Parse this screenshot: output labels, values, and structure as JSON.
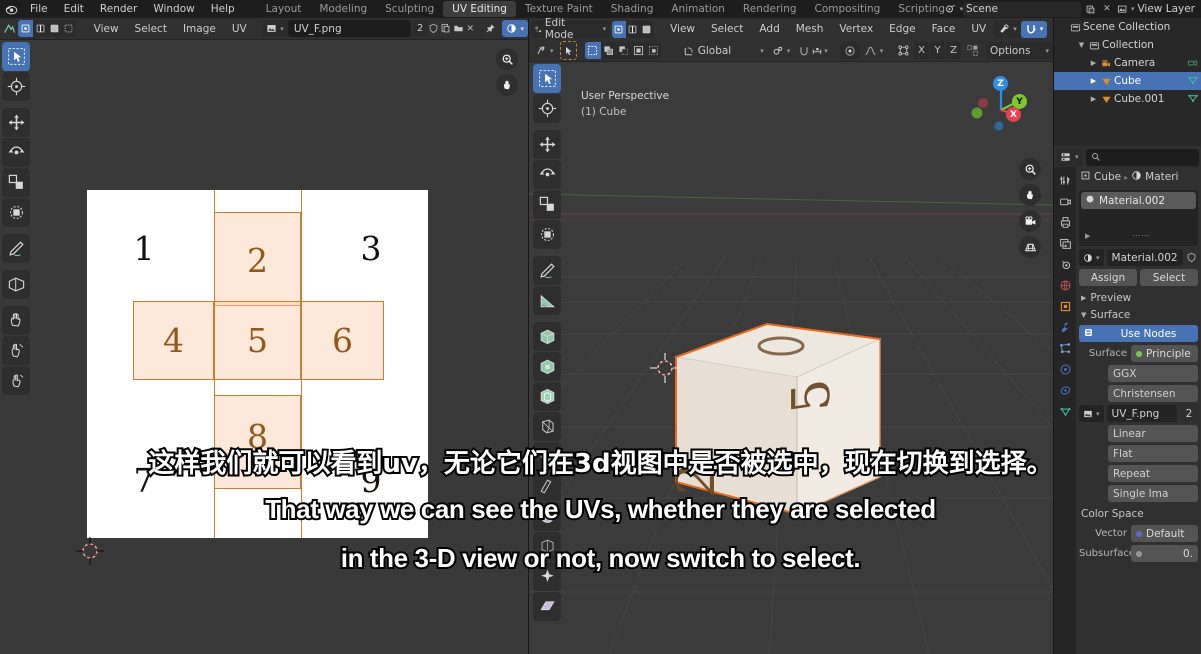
{
  "topbar": {
    "logo_icon": "blender-logo",
    "menus": [
      "File",
      "Edit",
      "Render",
      "Window",
      "Help"
    ],
    "workspace_tabs": [
      {
        "label": "Layout",
        "active": false
      },
      {
        "label": "Modeling",
        "active": false
      },
      {
        "label": "Sculpting",
        "active": false
      },
      {
        "label": "UV Editing",
        "active": true
      },
      {
        "label": "Texture Paint",
        "active": false
      },
      {
        "label": "Shading",
        "active": false
      },
      {
        "label": "Animation",
        "active": false
      },
      {
        "label": "Rendering",
        "active": false
      },
      {
        "label": "Compositing",
        "active": false
      },
      {
        "label": "Scripting",
        "active": false
      },
      {
        "label": "+",
        "active": false
      }
    ],
    "scene_name": "Scene",
    "view_layer_name": "View Layer",
    "scene_icon": "scene-icon",
    "view_layer_icon": "view-layer-icon",
    "new_scene_icon": "copy-icon",
    "remove_scene_icon": "close-icon"
  },
  "uv_editor": {
    "header": {
      "editor_type_icon": "uv-editor-icon",
      "mode_toggles": [
        "vertex-select-icon",
        "edge-select-icon",
        "face-select-icon",
        "island-select-icon"
      ],
      "menus": [
        "View",
        "Select",
        "Image",
        "UV"
      ],
      "image_browse_icon": "image-browse-icon",
      "image_name": "UV_F.png",
      "users_count": "2",
      "fake_user_icon": "shield-icon",
      "new_image_icon": "copy-icon",
      "open_image_icon": "folder-icon",
      "unlink_icon": "close-icon",
      "pin_icon": "pin-icon",
      "display_channel_icon": "color-channel-icon"
    },
    "tools": [
      {
        "name": "tweak-tool",
        "icon": "cursor-select-icon",
        "active": true
      },
      {
        "name": "cursor-tool",
        "icon": "crosshair-icon",
        "active": false
      },
      {
        "name": "move-tool",
        "icon": "move-arrows-icon",
        "active": false
      },
      {
        "name": "rotate-tool",
        "icon": "rotate-icon",
        "active": false
      },
      {
        "name": "scale-tool",
        "icon": "scale-icon",
        "active": false
      },
      {
        "name": "transform-tool",
        "icon": "transform-icon",
        "active": false
      },
      {
        "name": "annotate-tool",
        "icon": "pencil-icon",
        "active": false
      },
      {
        "name": "rip-region-tool",
        "icon": "rip-region-icon",
        "active": false
      },
      {
        "name": "grab-tool",
        "icon": "hand-grab-icon",
        "active": false
      },
      {
        "name": "relax-tool",
        "icon": "hand-relax-icon",
        "active": false
      },
      {
        "name": "pinch-tool",
        "icon": "hand-pinch-icon",
        "active": false
      }
    ],
    "nav": {
      "zoom_icon": "zoom-icon",
      "pan_icon": "hand-pan-icon"
    },
    "uv_map": {
      "image_label": "UV_F.png",
      "grid_numbers": [
        {
          "n": "1",
          "selected": false
        },
        {
          "n": "2",
          "selected": true
        },
        {
          "n": "3",
          "selected": false
        },
        {
          "n": "4",
          "selected": true
        },
        {
          "n": "5",
          "selected": true
        },
        {
          "n": "6",
          "selected": true
        },
        {
          "n": "7",
          "selected": false
        },
        {
          "n": "8",
          "selected": true
        },
        {
          "n": "9",
          "selected": false
        }
      ],
      "selected_face_fill": "#facdaa",
      "selected_face_edge": "#c97f2e",
      "unselected_number_color": "#17100c",
      "selected_number_color": "#93571a"
    },
    "cursor_2d_icon": "2d-cursor-icon"
  },
  "viewport_3d": {
    "header": {
      "editor_type_icon": "3d-viewport-icon",
      "mode": "Edit Mode",
      "mesh_select_modes": [
        "vertex-select-icon",
        "edge-select-icon",
        "face-select-icon"
      ],
      "menus": [
        "View",
        "Select",
        "Add",
        "Mesh",
        "Vertex",
        "Edge",
        "Face",
        "UV"
      ],
      "visibility_icon": "eye-dropdown-icon",
      "snap_magnet_icon": "magnet-icon",
      "second_row": {
        "cursor_icon": "editor-cursor-icon",
        "select_mode_icon": "tweak-icon",
        "select_modes": [
          "select-box-icon",
          "select-extend-icon",
          "select-subtract-icon",
          "select-invert-icon",
          "select-intersect-icon"
        ],
        "transform_orientation_icon": "orientation-icon",
        "transform_orientation": "Global",
        "pivot_icon": "pivot-icon",
        "snap_icon": "magnet-icon",
        "snap_target_icon": "snap-increment-icon",
        "proportional_icon": "proportional-edit-icon",
        "falloff_icon": "falloff-curve-icon",
        "uv_sync_icon": "uv-sync-icon",
        "axis_locks": [
          "X",
          "Y",
          "Z"
        ],
        "mirror_icon": "mirror-icon",
        "options_label": "Options"
      }
    },
    "overlay_text": {
      "line1": "User Perspective",
      "line2": "(1) Cube"
    },
    "tools": [
      {
        "name": "tweak-tool",
        "icon": "cursor-select-icon",
        "active": true
      },
      {
        "name": "cursor-tool",
        "icon": "crosshair-icon",
        "active": false
      },
      {
        "name": "move-tool",
        "icon": "move-arrows-icon",
        "active": false
      },
      {
        "name": "rotate-tool",
        "icon": "rotate-icon",
        "active": false
      },
      {
        "name": "scale-tool",
        "icon": "scale-icon",
        "active": false
      },
      {
        "name": "transform-tool",
        "icon": "transform-icon",
        "active": false
      },
      {
        "name": "annotate-tool",
        "icon": "pencil-icon",
        "active": false
      },
      {
        "name": "measure-tool",
        "icon": "ruler-icon",
        "active": false
      },
      {
        "name": "add-cube-tool",
        "icon": "add-cube-icon",
        "active": false
      },
      {
        "name": "extrude-region-tool",
        "icon": "extrude-icon",
        "active": false
      },
      {
        "name": "inset-faces-tool",
        "icon": "inset-faces-icon",
        "active": false
      },
      {
        "name": "bevel-tool",
        "icon": "bevel-icon",
        "active": false
      },
      {
        "name": "loop-cut-tool",
        "icon": "loop-cut-icon",
        "active": false
      },
      {
        "name": "knife-tool",
        "icon": "knife-icon",
        "active": false
      },
      {
        "name": "poly-build-tool",
        "icon": "poly-build-icon",
        "active": false
      },
      {
        "name": "spin-tool",
        "icon": "spin-icon",
        "active": false
      },
      {
        "name": "smooth-tool",
        "icon": "smooth-icon",
        "active": false
      },
      {
        "name": "shear-tool",
        "icon": "shear-icon",
        "active": false
      }
    ],
    "gizmo": {
      "axes": [
        {
          "label": "Z",
          "color": "#2c8fe8"
        },
        {
          "label": "Y",
          "color": "#7dc832"
        },
        {
          "label": "X",
          "color": "#e8424e"
        }
      ]
    },
    "nav_buttons": [
      {
        "name": "zoom-view-button",
        "icon": "zoom-icon"
      },
      {
        "name": "pan-view-button",
        "icon": "hand-pan-icon"
      },
      {
        "name": "camera-view-button",
        "icon": "camera-icon"
      },
      {
        "name": "toggle-perspective-button",
        "icon": "grid-perspective-icon"
      }
    ],
    "cube_face_numbers": [
      "2",
      "5"
    ]
  },
  "outliner": {
    "display_mode_icon": "outliner-icon",
    "rows": [
      {
        "label": "Scene Collection",
        "icon": "collection-icon",
        "depth": 0,
        "selected": false,
        "expander": ""
      },
      {
        "label": "Collection",
        "icon": "collection-icon",
        "depth": 1,
        "selected": false,
        "expander": "open"
      },
      {
        "label": "Camera",
        "icon": "camera-obj-icon",
        "depth": 2,
        "selected": false,
        "expander": "closed",
        "data_icon": "camera-data-icon"
      },
      {
        "label": "Cube",
        "icon": "mesh-obj-icon",
        "depth": 2,
        "selected": true,
        "expander": "closed",
        "data_icon": "mesh-data-icon"
      },
      {
        "label": "Cube.001",
        "icon": "mesh-obj-icon",
        "depth": 2,
        "selected": false,
        "expander": "closed",
        "data_icon": "mesh-data-icon"
      }
    ]
  },
  "properties": {
    "editor_icon": "properties-icon",
    "search_placeholder": "",
    "search_icon": "search-icon",
    "tabs": [
      {
        "name": "tool-tab",
        "icon": "tool-icon"
      },
      {
        "name": "render-tab",
        "icon": "render-camera-icon"
      },
      {
        "name": "output-tab",
        "icon": "printer-icon"
      },
      {
        "name": "view-layer-tab",
        "icon": "images-icon"
      },
      {
        "name": "scene-tab",
        "icon": "scene-cone-icon"
      },
      {
        "name": "world-tab",
        "icon": "world-icon"
      },
      {
        "name": "object-tab",
        "icon": "object-square-icon"
      },
      {
        "name": "modifier-tab",
        "icon": "wrench-icon"
      },
      {
        "name": "particles-tab",
        "icon": "particles-icon"
      },
      {
        "name": "physics-tab",
        "icon": "physics-icon"
      },
      {
        "name": "constraints-tab",
        "icon": "constraints-icon"
      },
      {
        "name": "data-tab",
        "icon": "mesh-data-icon"
      },
      {
        "name": "material-tab",
        "icon": "material-sphere-icon"
      }
    ],
    "breadcrumb": [
      {
        "label": "Cube",
        "icon": "object-square-icon"
      },
      {
        "label": "Materi",
        "icon": "material-sphere-icon"
      }
    ],
    "material_slot": "Material.002",
    "material_name": "Material.002",
    "fake_user_icon": "shield-icon",
    "assign_label": "Assign",
    "select_label": "Select",
    "preview_label": "Preview",
    "surface_label": "Surface",
    "use_nodes_label": "Use Nodes",
    "surface_field_label": "Surface",
    "surface_value": "Principle",
    "distribution_value": "GGX",
    "subsurface_method_value": "Christensen",
    "image_icon": "image-browse-icon",
    "image_name": "UV_F.png",
    "image_users": "2",
    "interpolation": "Linear",
    "projection": "Flat",
    "extension": "Repeat",
    "source": "Single Ima",
    "color_space_label": "Color Space",
    "vector_label": "Vector",
    "vector_value": "Default",
    "subsurface_label": "Subsurface",
    "subsurface_value": "0."
  },
  "subtitles": {
    "chinese": "这样我们就可以看到uv，无论它们在3d视图中是否被选中，现在切换到选择。",
    "english_line1": "That way we can see the UVs, whether they are selected",
    "english_line2": "in the 3-D view or not, now switch to select."
  }
}
